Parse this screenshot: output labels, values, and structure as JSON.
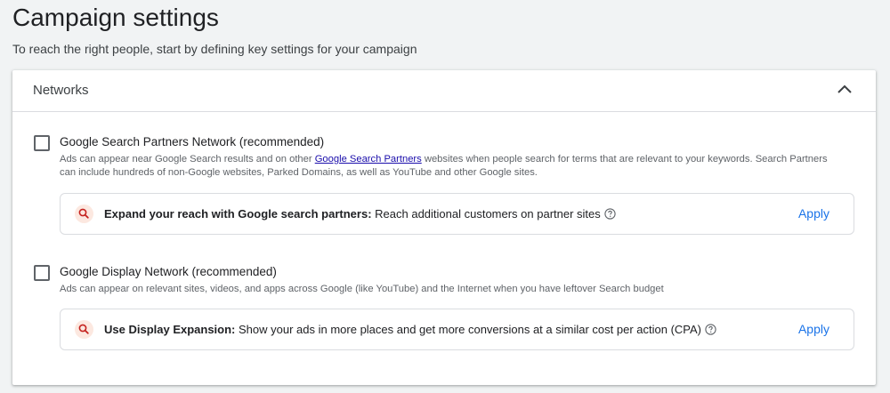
{
  "page": {
    "title": "Campaign settings",
    "subtitle": "To reach the right people, start by defining key settings for your campaign"
  },
  "networks_card": {
    "title": "Networks",
    "collapse_icon": "chevron-up-icon",
    "options": [
      {
        "title": "Google Search Partners Network (recommended)",
        "checked": false,
        "desc_before_link": "Ads can appear near Google Search results and on other ",
        "desc_link": "Google Search Partners",
        "desc_after_link": " websites when people search for terms that are relevant to your keywords. Search Partners can include hundreds of non-Google websites, Parked Domains, as well as YouTube and other Google sites.",
        "recommendation": {
          "icon": "search-icon",
          "bold": "Expand your reach with Google search partners:",
          "text": " Reach additional customers on partner sites",
          "help_icon": "help-circle-icon",
          "action": "Apply"
        }
      },
      {
        "title": "Google Display Network (recommended)",
        "checked": false,
        "desc": "Ads can appear on relevant sites, videos, and apps across Google (like YouTube) and the Internet when you have leftover Search budget",
        "recommendation": {
          "icon": "search-icon",
          "bold": "Use Display Expansion:",
          "text": " Show your ads in more places and get more conversions at a similar cost per action (CPA)",
          "help_icon": "help-circle-icon",
          "action": "Apply"
        }
      }
    ]
  },
  "colors": {
    "background": "#f1f3f4",
    "card": "#ffffff",
    "link": "#1a0dab",
    "action": "#1a73e8",
    "icon_badge": "#fce8e0",
    "icon_stroke": "#c5221f"
  }
}
